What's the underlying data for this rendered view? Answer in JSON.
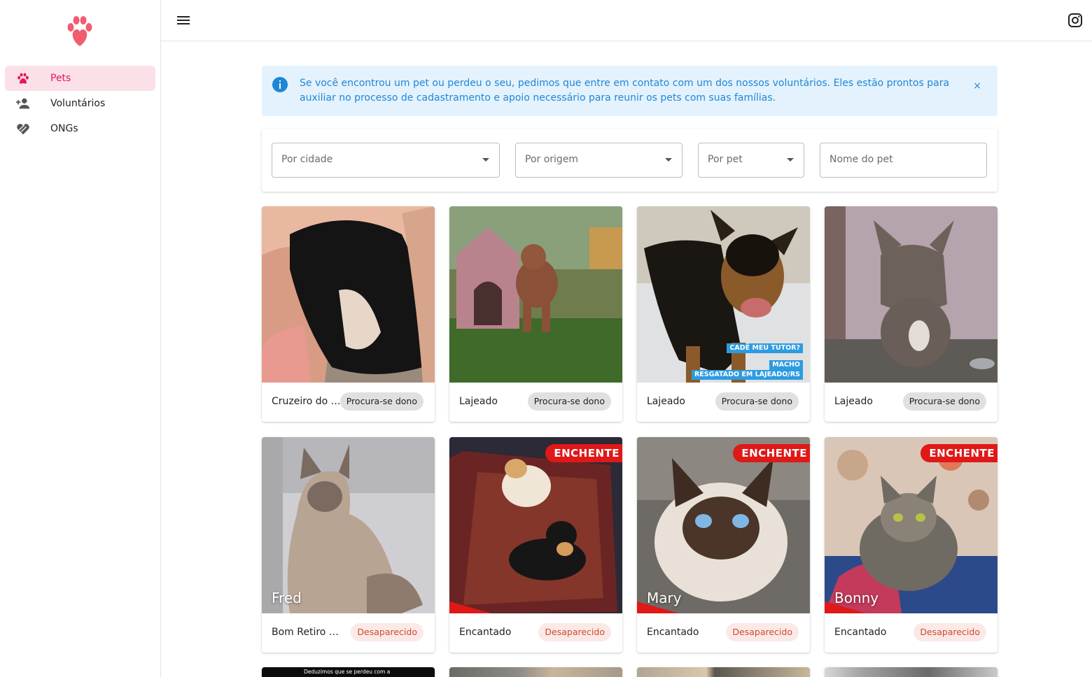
{
  "sidebar": {
    "items": [
      {
        "label": "Pets",
        "icon": "paw-icon",
        "active": true
      },
      {
        "label": "Voluntários",
        "icon": "person-add-icon",
        "active": false
      },
      {
        "label": "ONGs",
        "icon": "volunteer-hand-heart-icon",
        "active": false
      }
    ]
  },
  "topbar": {
    "menu_icon": "hamburger-menu-icon",
    "social_icon": "instagram-icon"
  },
  "alert": {
    "text": "Se você encontrou um pet ou perdeu o seu, pedimos que entre em contato com um dos nossos voluntários. Eles estão prontos para auxiliar no processo de cadastramento e apoio necessário para reunir os pets com suas famílias.",
    "close": "×"
  },
  "filters": {
    "city": "Por cidade",
    "origin": "Por origem",
    "pet": "Por pet",
    "name_placeholder": "Nome do pet"
  },
  "colors": {
    "accent": "#e3185c",
    "found_chip": "#e0e0e0",
    "lost_chip_bg": "#fbe9e7",
    "lost_chip_text": "#d04a2c",
    "alert_text": "#1f87d6"
  },
  "cards": [
    {
      "city": "Cruzeiro do Sul",
      "status": "Procura-se dono",
      "name": "",
      "banner": ""
    },
    {
      "city": "Lajeado",
      "status": "Procura-se dono",
      "name": "",
      "banner": ""
    },
    {
      "city": "Lajeado",
      "status": "Procura-se dono",
      "name": "",
      "banner": ""
    },
    {
      "city": "Lajeado",
      "status": "Procura-se dono",
      "name": "",
      "banner": ""
    },
    {
      "city": "Bom Retiro do Sul",
      "status": "Desaparecido",
      "name": "Fred",
      "banner": ""
    },
    {
      "city": "Encantado",
      "status": "Desaparecido",
      "name": "",
      "banner": "ENCHENTE"
    },
    {
      "city": "Encantado",
      "status": "Desaparecido",
      "name": "Mary",
      "banner": "ENCHENTE"
    },
    {
      "city": "Encantado",
      "status": "Desaparecido",
      "name": "Bonny",
      "banner": "ENCHENTE"
    }
  ],
  "photo_captions": {
    "card3_line1": "CADÊ MEU TUTOR?",
    "card3_line2": "MACHO",
    "card3_line3": "RESGATADO EM LAJEADO/RS",
    "row3_card1": "Deduzimos que se perdeu com a"
  }
}
